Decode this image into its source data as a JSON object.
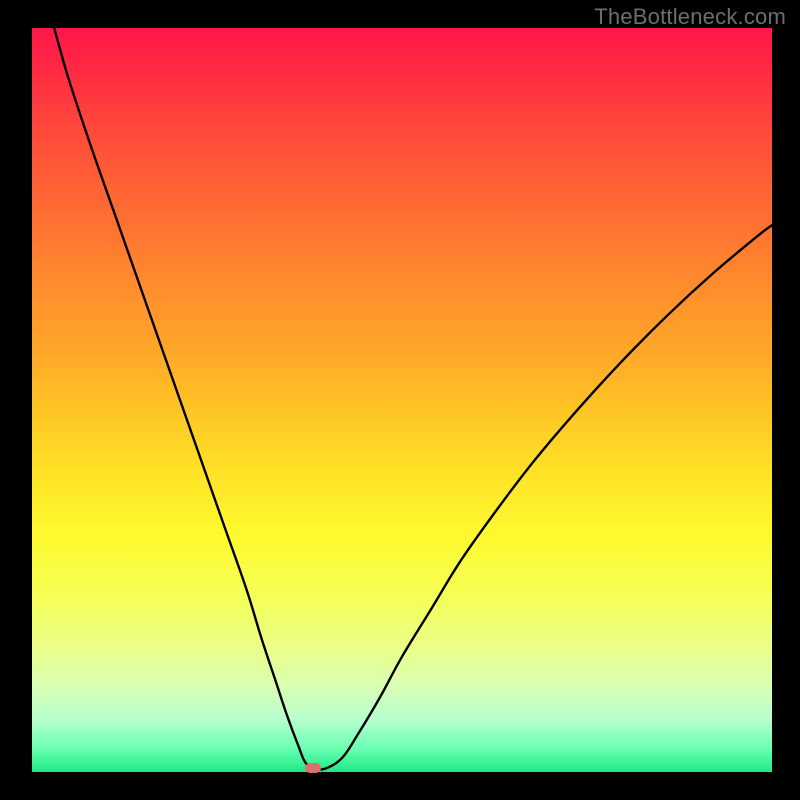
{
  "watermark": "TheBottleneck.com",
  "chart_data": {
    "type": "line",
    "title": "",
    "xlabel": "",
    "ylabel": "",
    "xlim": [
      0,
      100
    ],
    "ylim": [
      0,
      100
    ],
    "grid": false,
    "legend": false,
    "background": "rainbow-vertical-red-to-green",
    "series": [
      {
        "name": "bottleneck-curve",
        "color": "#000000",
        "x": [
          3,
          5,
          8,
          11,
          14,
          17,
          20,
          23,
          26,
          29,
          31,
          33,
          34.5,
          36,
          37,
          38.5,
          40,
          42,
          44,
          47,
          50,
          54,
          58,
          63,
          68,
          74,
          80,
          86,
          92,
          98,
          100
        ],
        "y": [
          100,
          93,
          84,
          75.5,
          67,
          58.5,
          50,
          41.5,
          33,
          24.5,
          18,
          12,
          7.5,
          3.5,
          1.2,
          0.4,
          0.6,
          2,
          5,
          10,
          15.5,
          22,
          28.5,
          35.5,
          42,
          49,
          55.5,
          61.5,
          67,
          72,
          73.5
        ]
      }
    ],
    "markers": [
      {
        "name": "min-point",
        "x": 38,
        "y": 0.6,
        "color": "#d9726b"
      }
    ]
  }
}
